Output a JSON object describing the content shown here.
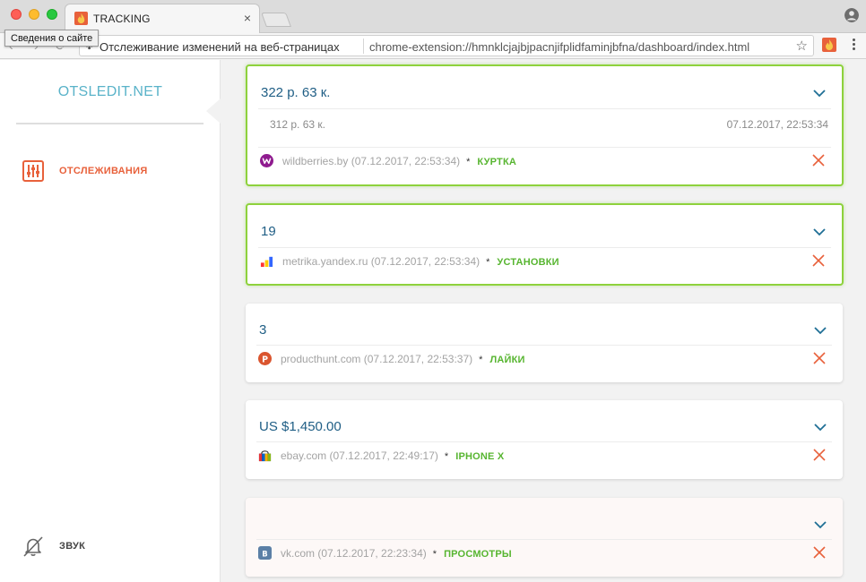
{
  "browser": {
    "tab_title": "TRACKING",
    "tab_close": "×",
    "tooltip": "Сведения о сайте",
    "site_info": "Отслеживание изменений на веб-страницах",
    "url": "chrome-extension://hmnklcjajbjpacnjifplidfaminjbfna/dashboard/index.html",
    "star": "☆"
  },
  "sidebar": {
    "logo": "OTSLEDIT.NET",
    "tracking_label": "ОТСЛЕЖИВАНИЯ",
    "sound_label": "ЗВУК"
  },
  "colors": {
    "accent": "#e8613b",
    "value_text": "#1f5e85",
    "changed_border": "#8ed23c",
    "tag_green": "#57b530"
  },
  "cards": [
    {
      "value": "322 р. 63 к.",
      "previous_value": "312 р. 63 к.",
      "previous_time": "07.12.2017, 22:53:34",
      "site": "wildberries.by (07.12.2017, 22:53:34)",
      "bullet": "*",
      "tag": "КУРТКА",
      "favicon": "wildberries-icon",
      "changed": true
    },
    {
      "value": "19",
      "site": "metrika.yandex.ru (07.12.2017, 22:53:34)",
      "bullet": "*",
      "tag": "УСТАНОВКИ",
      "favicon": "yandex-metrika-icon",
      "changed": true
    },
    {
      "value": "3",
      "site": "producthunt.com (07.12.2017, 22:53:37)",
      "bullet": "*",
      "tag": "ЛАЙКИ",
      "favicon": "producthunt-icon",
      "changed": false
    },
    {
      "value": "US $1,450.00",
      "site": "ebay.com (07.12.2017, 22:49:17)",
      "bullet": "*",
      "tag": "IPHONE X",
      "favicon": "ebay-icon",
      "changed": false
    },
    {
      "value": "",
      "site": "vk.com (07.12.2017, 22:23:34)",
      "bullet": "*",
      "tag": "ПРОСМОТРЫ",
      "favicon": "vk-icon",
      "changed": false
    }
  ]
}
